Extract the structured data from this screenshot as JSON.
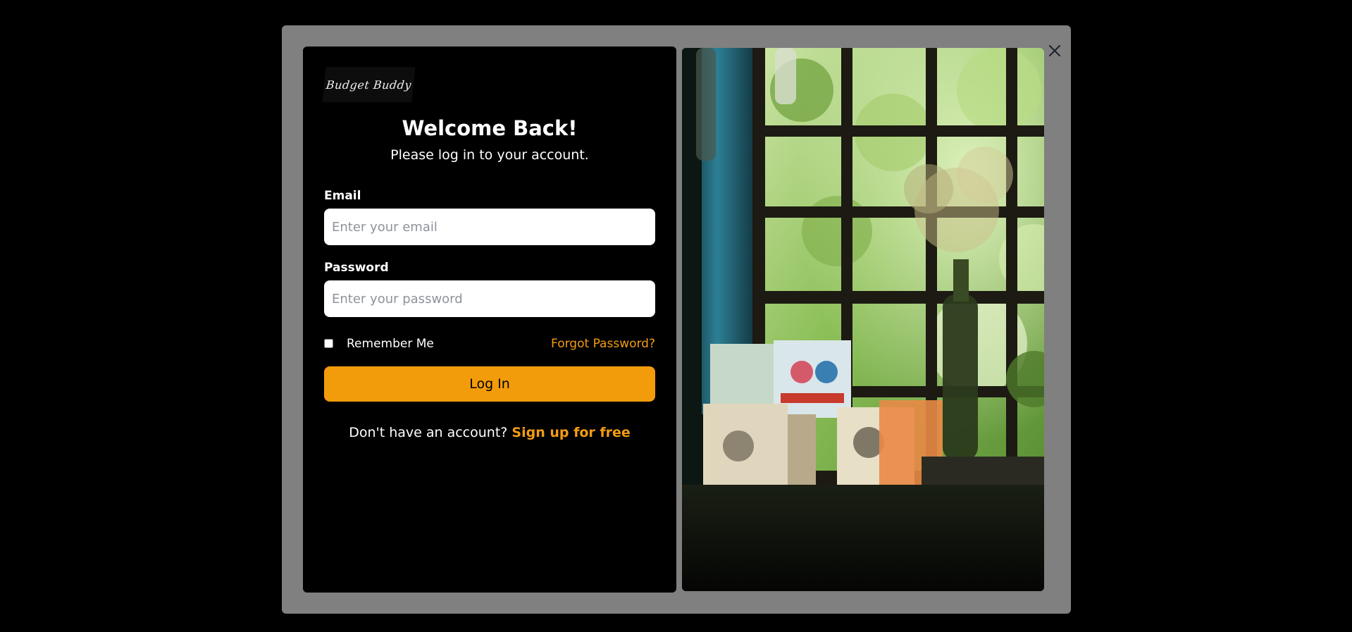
{
  "modal": {
    "close_icon": "close-icon"
  },
  "login": {
    "logo_text": "Budget Buddy",
    "title": "Welcome Back!",
    "subtitle": "Please log in to your account.",
    "email": {
      "label": "Email",
      "value": "",
      "placeholder": "Enter your email"
    },
    "password": {
      "label": "Password",
      "value": "",
      "placeholder": "Enter your password"
    },
    "remember_me": {
      "label": "Remember Me",
      "checked": false
    },
    "forgot_password": "Forgot Password?",
    "submit_label": "Log In",
    "signup_prompt": "Don't have an account?",
    "signup_link": "Sign up for free"
  },
  "photo": {
    "subject": "window-still-life-photo"
  },
  "colors": {
    "accent": "#f39c0b",
    "link": "#f39c12",
    "modal_backdrop": "#808080",
    "card_bg": "#000000",
    "page_bg": "#000000"
  }
}
